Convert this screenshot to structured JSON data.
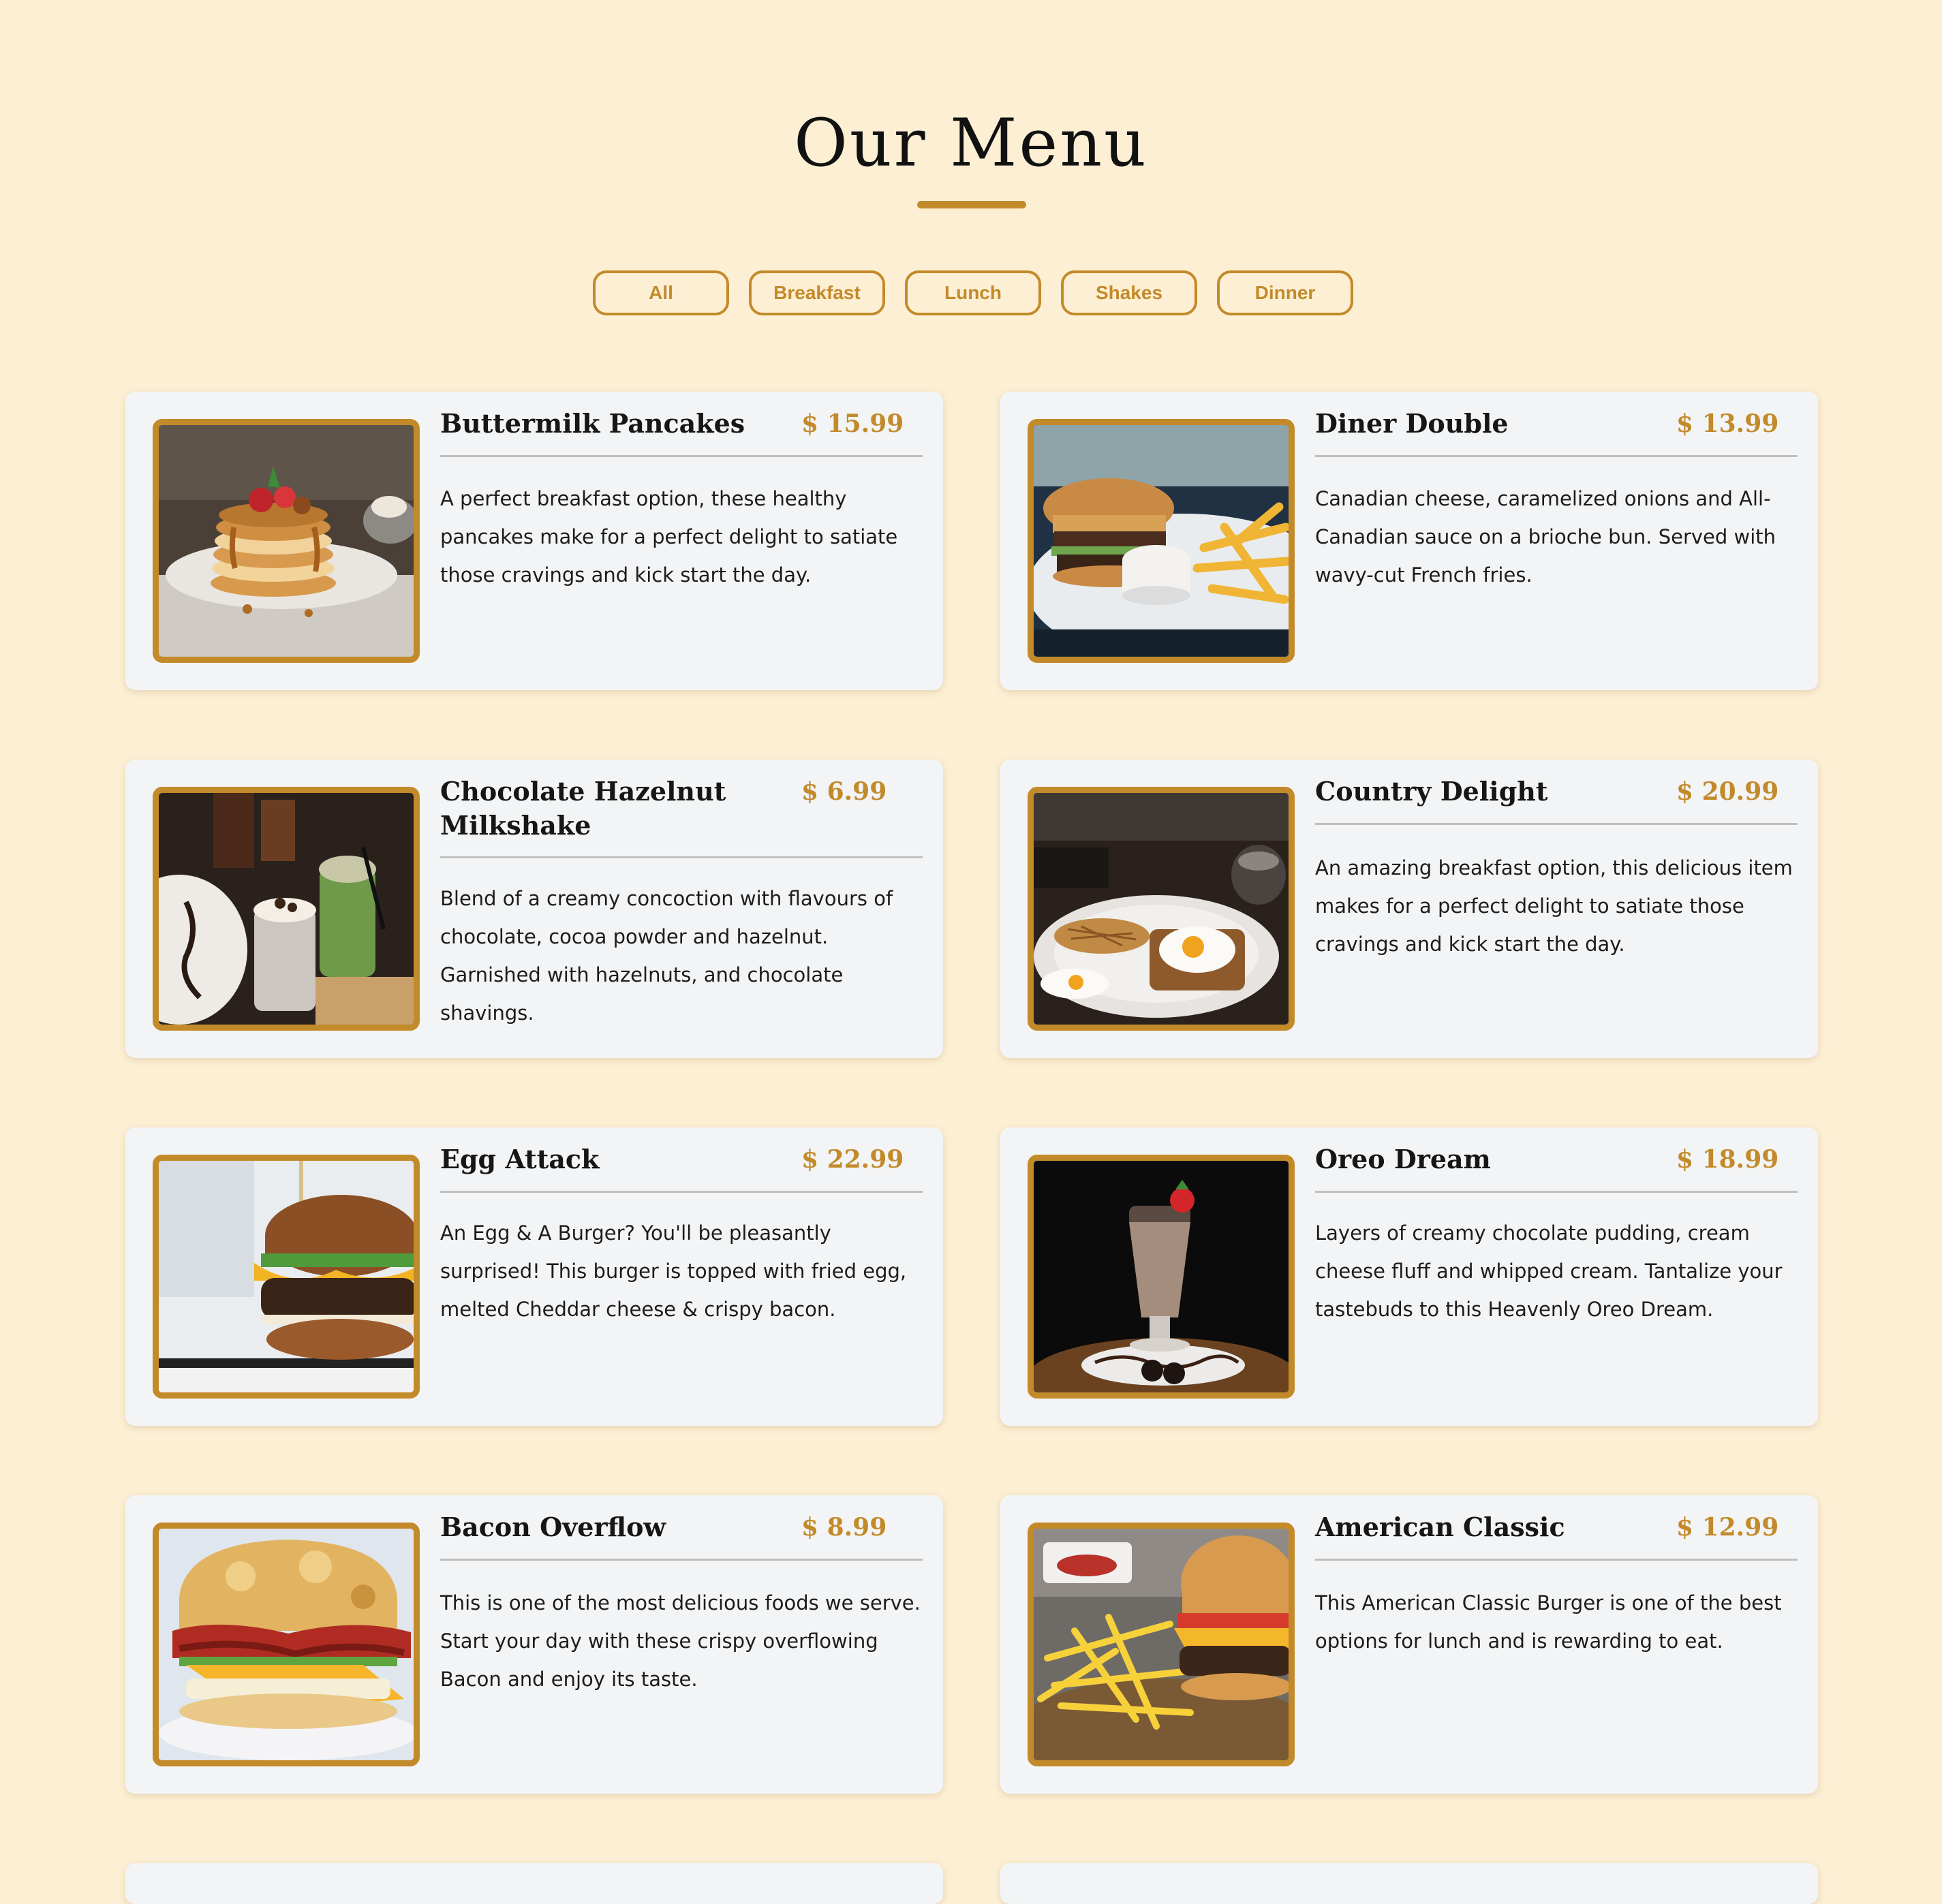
{
  "header": {
    "title": "Our Menu"
  },
  "filters": [
    {
      "label": "All"
    },
    {
      "label": "Breakfast"
    },
    {
      "label": "Lunch"
    },
    {
      "label": "Shakes"
    },
    {
      "label": "Dinner"
    }
  ],
  "menu": {
    "items": [
      {
        "name": "Buttermilk Pancakes",
        "price": "$ 15.99",
        "description": "A perfect breakfast option, these healthy pancakes make for a perfect delight to satiate those cravings and kick start the day.",
        "image": "pancake-stack-photo"
      },
      {
        "name": "Diner Double",
        "price": "$ 13.99",
        "description": "Canadian cheese, caramelized onions and All-Canadian sauce on a brioche bun. Served with wavy-cut French fries.",
        "image": "burger-with-fries-photo"
      },
      {
        "name": "Chocolate Hazelnut Milkshake",
        "price": "$ 6.99",
        "description": "Blend of a creamy concoction with flavours of chocolate, cocoa powder and hazelnut. Garnished with hazelnuts, and chocolate shavings.",
        "image": "milkshakes-photo"
      },
      {
        "name": "Country Delight",
        "price": "$ 20.99",
        "description": "An amazing breakfast option, this delicious item makes for a perfect delight to satiate those cravings and kick start the day.",
        "image": "fried-eggs-toast-photo"
      },
      {
        "name": "Egg Attack",
        "price": "$ 22.99",
        "description": "An Egg & A Burger? You'll be pleasantly surprised! This burger is topped with fried egg, melted Cheddar cheese & crispy bacon.",
        "image": "egg-burger-photo"
      },
      {
        "name": "Oreo Dream",
        "price": "$ 18.99",
        "description": "Layers of creamy chocolate pudding, cream cheese fluff and whipped cream. Tantalize your tastebuds to this Heavenly Oreo Dream.",
        "image": "oreo-shake-photo"
      },
      {
        "name": "Bacon Overflow",
        "price": "$ 8.99",
        "description": "This is one of the most delicious foods we serve. Start your day with these crispy overflowing Bacon and enjoy its taste.",
        "image": "bacon-biscuit-photo"
      },
      {
        "name": "American Classic",
        "price": "$ 12.99",
        "description": "This American Classic Burger is one of the best options for lunch and is rewarding to eat.",
        "image": "classic-burger-fries-photo"
      }
    ]
  },
  "colors": {
    "background": "#fdefd4",
    "accent": "#c38a2a",
    "card": "#f3f4f5",
    "text": "#161616"
  }
}
